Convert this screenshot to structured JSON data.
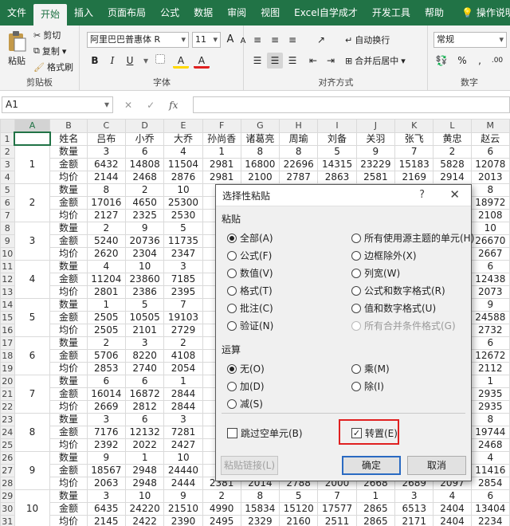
{
  "ribbon_tabs": [
    "文件",
    "开始",
    "插入",
    "页面布局",
    "公式",
    "数据",
    "审阅",
    "视图",
    "Excel自学成才",
    "开发工具",
    "帮助"
  ],
  "active_tab": "开始",
  "tell_me": "操作说明搜索",
  "clipboard": {
    "paste": "粘贴",
    "cut": "剪切",
    "copy": "复制",
    "format_painter": "格式刷",
    "label": "剪贴板"
  },
  "font": {
    "name": "阿里巴巴普惠体 R",
    "size": "11",
    "increase": "A",
    "decrease": "A",
    "bold": "B",
    "italic": "I",
    "underline": "U",
    "fill_letter": "A",
    "font_color_letter": "A",
    "label": "字体"
  },
  "alignment": {
    "wrap": "自动换行",
    "merge": "合并后居中",
    "label": "对齐方式"
  },
  "number": {
    "format": "常规",
    "label": "数字"
  },
  "formula_bar": {
    "name_box": "A1",
    "cancel": "✕",
    "enter": "✓",
    "fx": "fx",
    "content": ""
  },
  "columns": [
    "A",
    "B",
    "C",
    "D",
    "E",
    "F",
    "G",
    "H",
    "I",
    "J",
    "K",
    "L",
    "M"
  ],
  "header_row": [
    "",
    "姓名",
    "吕布",
    "小乔",
    "大乔",
    "孙尚香",
    "诸葛亮",
    "周瑜",
    "刘备",
    "关羽",
    "张飞",
    "黄忠",
    "赵云"
  ],
  "groups": [
    {
      "id": "1",
      "rows": [
        [
          "数量",
          "3",
          "6",
          "4",
          "1",
          "8",
          "8",
          "5",
          "9",
          "7",
          "2",
          "6"
        ],
        [
          "金额",
          "6432",
          "14808",
          "11504",
          "2981",
          "16800",
          "22696",
          "14315",
          "23229",
          "15183",
          "5828",
          "12078"
        ],
        [
          "均价",
          "2144",
          "2468",
          "2876",
          "2981",
          "2100",
          "2787",
          "2863",
          "2581",
          "2169",
          "2914",
          "2013"
        ]
      ]
    },
    {
      "id": "2",
      "rows": [
        [
          "数量",
          "8",
          "2",
          "10",
          "",
          "",
          "",
          "",
          "",
          "",
          "",
          "8"
        ],
        [
          "金额",
          "17016",
          "4650",
          "25300",
          "",
          "",
          "",
          "",
          "",
          "",
          "",
          "18972"
        ],
        [
          "均价",
          "2127",
          "2325",
          "2530",
          "",
          "",
          "",
          "",
          "",
          "",
          "",
          "2108"
        ]
      ]
    },
    {
      "id": "3",
      "rows": [
        [
          "数量",
          "2",
          "9",
          "5",
          "",
          "",
          "",
          "",
          "",
          "",
          "",
          "10"
        ],
        [
          "金额",
          "5240",
          "20736",
          "11735",
          "",
          "",
          "",
          "",
          "",
          "",
          "",
          "26670"
        ],
        [
          "均价",
          "2620",
          "2304",
          "2347",
          "",
          "",
          "",
          "",
          "",
          "",
          "",
          "2667"
        ]
      ]
    },
    {
      "id": "4",
      "rows": [
        [
          "数量",
          "4",
          "10",
          "3",
          "",
          "",
          "",
          "",
          "",
          "",
          "",
          "6"
        ],
        [
          "金额",
          "11204",
          "23860",
          "7185",
          "",
          "",
          "",
          "",
          "",
          "",
          "",
          "12438"
        ],
        [
          "均价",
          "2801",
          "2386",
          "2395",
          "",
          "",
          "",
          "",
          "",
          "",
          "",
          "2073"
        ]
      ]
    },
    {
      "id": "5",
      "rows": [
        [
          "数量",
          "1",
          "5",
          "7",
          "",
          "",
          "",
          "",
          "",
          "",
          "",
          "9"
        ],
        [
          "金额",
          "2505",
          "10505",
          "19103",
          "",
          "",
          "",
          "",
          "",
          "",
          "",
          "24588"
        ],
        [
          "均价",
          "2505",
          "2101",
          "2729",
          "",
          "",
          "",
          "",
          "",
          "",
          "",
          "2732"
        ]
      ]
    },
    {
      "id": "6",
      "rows": [
        [
          "数量",
          "2",
          "3",
          "2",
          "",
          "",
          "",
          "",
          "",
          "",
          "",
          "6"
        ],
        [
          "金额",
          "5706",
          "8220",
          "4108",
          "",
          "",
          "",
          "",
          "",
          "",
          "",
          "12672"
        ],
        [
          "均价",
          "2853",
          "2740",
          "2054",
          "",
          "",
          "",
          "",
          "",
          "",
          "",
          "2112"
        ]
      ]
    },
    {
      "id": "7",
      "rows": [
        [
          "数量",
          "6",
          "6",
          "1",
          "",
          "",
          "",
          "",
          "",
          "",
          "",
          "1"
        ],
        [
          "金额",
          "16014",
          "16872",
          "2844",
          "",
          "",
          "",
          "",
          "",
          "",
          "",
          "2935"
        ],
        [
          "均价",
          "2669",
          "2812",
          "2844",
          "",
          "",
          "",
          "",
          "",
          "",
          "",
          "2935"
        ]
      ]
    },
    {
      "id": "8",
      "rows": [
        [
          "数量",
          "3",
          "6",
          "3",
          "",
          "",
          "",
          "",
          "",
          "",
          "",
          "8"
        ],
        [
          "金额",
          "7176",
          "12132",
          "7281",
          "",
          "",
          "",
          "",
          "",
          "",
          "",
          "19744"
        ],
        [
          "均价",
          "2392",
          "2022",
          "2427",
          "",
          "",
          "",
          "",
          "",
          "",
          "",
          "2468"
        ]
      ]
    },
    {
      "id": "9",
      "rows": [
        [
          "数量",
          "9",
          "1",
          "10",
          "",
          "",
          "",
          "",
          "",
          "",
          "",
          "4"
        ],
        [
          "金额",
          "18567",
          "2948",
          "24440",
          "",
          "",
          "",
          "",
          "",
          "",
          "",
          "11416"
        ],
        [
          "均价",
          "2063",
          "2948",
          "2444",
          "2381",
          "2014",
          "2788",
          "2000",
          "2668",
          "2689",
          "2097",
          "2854"
        ]
      ]
    },
    {
      "id": "10",
      "rows": [
        [
          "数量",
          "3",
          "10",
          "9",
          "2",
          "8",
          "5",
          "7",
          "1",
          "3",
          "4",
          "6"
        ],
        [
          "金额",
          "6435",
          "24220",
          "21510",
          "4990",
          "15834",
          "15120",
          "17577",
          "2865",
          "6513",
          "2404",
          "13404"
        ],
        [
          "均价",
          "2145",
          "2422",
          "2390",
          "2495",
          "2329",
          "2160",
          "2511",
          "2865",
          "2171",
          "2404",
          "2234"
        ]
      ]
    }
  ],
  "dialog": {
    "title": "选择性粘贴",
    "help": "?",
    "close": "✕",
    "paste_label": "粘贴",
    "paste_left": [
      "全部(A)",
      "公式(F)",
      "数值(V)",
      "格式(T)",
      "批注(C)",
      "验证(N)"
    ],
    "paste_right": [
      "所有使用源主题的单元(H)",
      "边框除外(X)",
      "列宽(W)",
      "公式和数字格式(R)",
      "值和数字格式(U)",
      "所有合并条件格式(G)"
    ],
    "operation_label": "运算",
    "op_left": [
      "无(O)",
      "加(D)",
      "减(S)"
    ],
    "op_right": [
      "乘(M)",
      "除(I)"
    ],
    "skip_blanks": "跳过空单元(B)",
    "transpose": "转置(E)",
    "transpose_mark": "✓",
    "paste_link": "粘贴链接(L)",
    "ok": "确定",
    "cancel": "取消"
  }
}
